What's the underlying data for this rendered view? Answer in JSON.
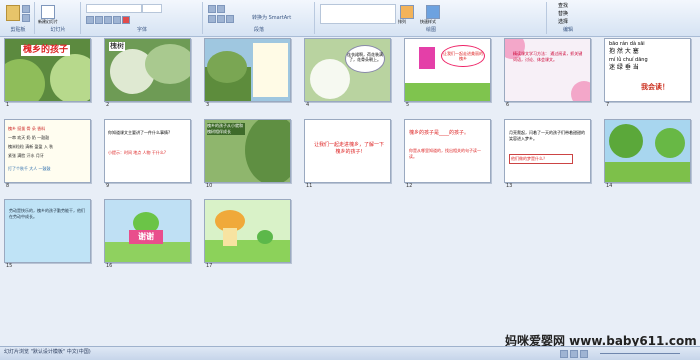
{
  "ribbon": {
    "groups": [
      "剪贴板",
      "幻灯片",
      "字体",
      "段落",
      "绘图",
      "编辑"
    ],
    "buttons": {
      "new_slide": "新建幻灯片",
      "shape": "形状",
      "arrange": "排列",
      "quick_style": "快速样式",
      "find": "查找",
      "replace": "替换",
      "select": "选择"
    },
    "smartart": "转换为 SmartArt"
  },
  "slides": [
    {
      "n": "1",
      "title": "槐乡的孩子"
    },
    {
      "n": "2",
      "label": "槐树"
    },
    {
      "n": "3"
    },
    {
      "n": "4",
      "text": "连衣裙啊，荷花装满了，花骨朵朝上。"
    },
    {
      "n": "5",
      "text": "让我们一起走进美丽的槐乡"
    },
    {
      "n": "6",
      "text": "精读课文学习方法： 通过阅读，抓关键词语，讨论、体会课文。"
    },
    {
      "n": "7",
      "rows": [
        "bāo  rán  dà  sāi",
        "抱  然  大  塞",
        "mí  lǜ  chuí  dāng",
        "迷  绿  垂  当"
      ],
      "foot": "我会读！"
    },
    {
      "n": "8",
      "lines": [
        "槐乡  挺拔  骨  朵  香料",
        "一串  欢天  奶  奶  一鼓鼓",
        "槐米粒粒  清新  盈盈  入 秋",
        "紧张  满脸 汗水  月牙",
        "打了个秋千  大人  一鼓鼓"
      ]
    },
    {
      "n": "9",
      "lines": [
        "你知道课文主要讲了一件什么事情?",
        "小提示：时间 地点 人物 干什么?"
      ]
    },
    {
      "n": "10",
      "text": "槐乡的孩子从小就和槐树相伴成长"
    },
    {
      "n": "11",
      "text": "让我们一起走进槐乡，了解一下槐乡的孩子!"
    },
    {
      "n": "12",
      "lines": [
        "槐乡的孩子是____的孩子。",
        "你是从哪里知道的，找出相关的句子读一读。"
      ]
    },
    {
      "n": "13",
      "lines": [
        "月亮爬起，闪着了一天的孩子们带着甜甜的笑容进入梦乡。",
        "他们做的梦是什么？"
      ]
    },
    {
      "n": "14"
    },
    {
      "n": "15",
      "text": "劳动是快乐的，槐乡的孩子勤劳能干，他们在劳动中成长。"
    },
    {
      "n": "16",
      "text": "谢谢"
    },
    {
      "n": "17"
    }
  ],
  "status": {
    "left": "幻灯片浏览  \"默认设计模板\"  中文(中国)",
    "watermark": "妈咪爱婴网 www.baby611.com"
  }
}
